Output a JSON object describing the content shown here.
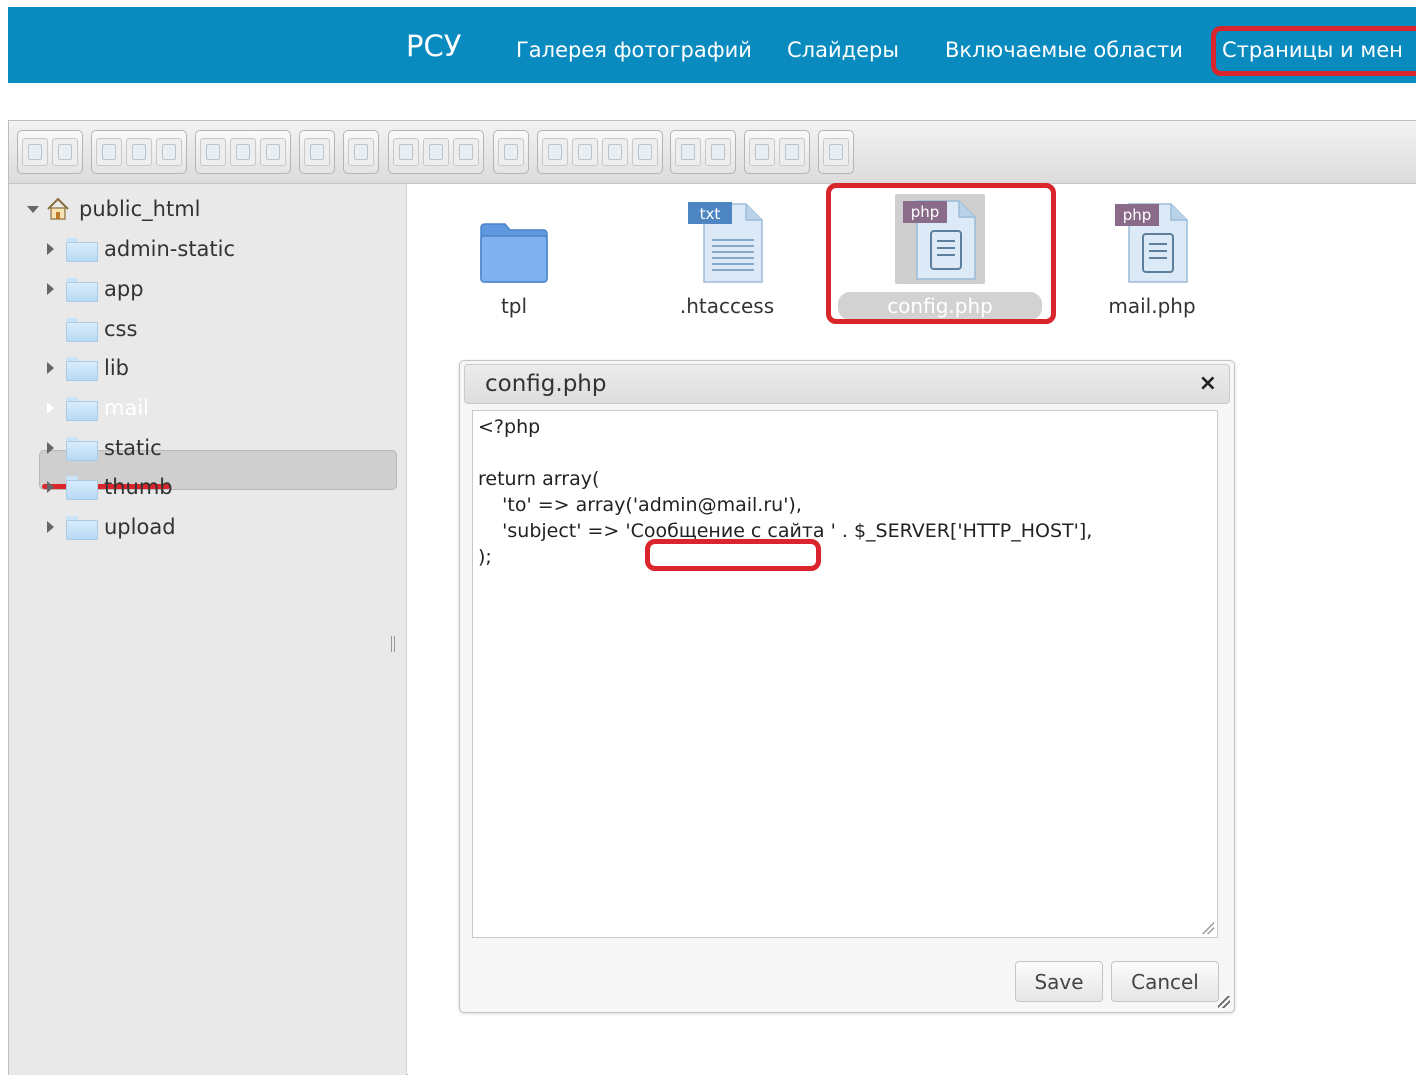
{
  "nav": {
    "brand": "РСУ",
    "items": [
      "Галерея фотографий",
      "Слайдеры",
      "Включаемые области",
      "Страницы и мен"
    ]
  },
  "toolbar": {
    "groups": [
      "back-forward",
      "new-items",
      "upload-download",
      "info",
      "preview",
      "clipboard",
      "rename",
      "edit-archive",
      "extract",
      "view",
      "help"
    ]
  },
  "tree": {
    "root": "public_html",
    "items": [
      {
        "label": "admin-static",
        "expandable": true
      },
      {
        "label": "app",
        "expandable": true
      },
      {
        "label": "css",
        "expandable": false
      },
      {
        "label": "lib",
        "expandable": true
      },
      {
        "label": "mail",
        "expandable": true,
        "selected": true
      },
      {
        "label": "static",
        "expandable": true
      },
      {
        "label": "thumb",
        "expandable": true
      },
      {
        "label": "upload",
        "expandable": true
      }
    ]
  },
  "files": [
    {
      "name": "tpl",
      "type": "folder"
    },
    {
      "name": ".htaccess",
      "type": "txt",
      "badge": "txt"
    },
    {
      "name": "config.php",
      "type": "php",
      "badge": "php",
      "selected": true
    },
    {
      "name": "mail.php",
      "type": "php",
      "badge": "php"
    }
  ],
  "dialog": {
    "title": "config.php",
    "close_icon": "×",
    "code": [
      "<?php",
      "",
      "return array(",
      "    'to' => array('admin@mail.ru'),",
      "    'subject' => 'Сообщение с сайта ' . $_SERVER['HTTP_HOST'],",
      ");"
    ],
    "save_label": "Save",
    "cancel_label": "Cancel"
  },
  "colors": {
    "nav_bg": "#0a8bc0",
    "highlight": "#d9252b"
  }
}
